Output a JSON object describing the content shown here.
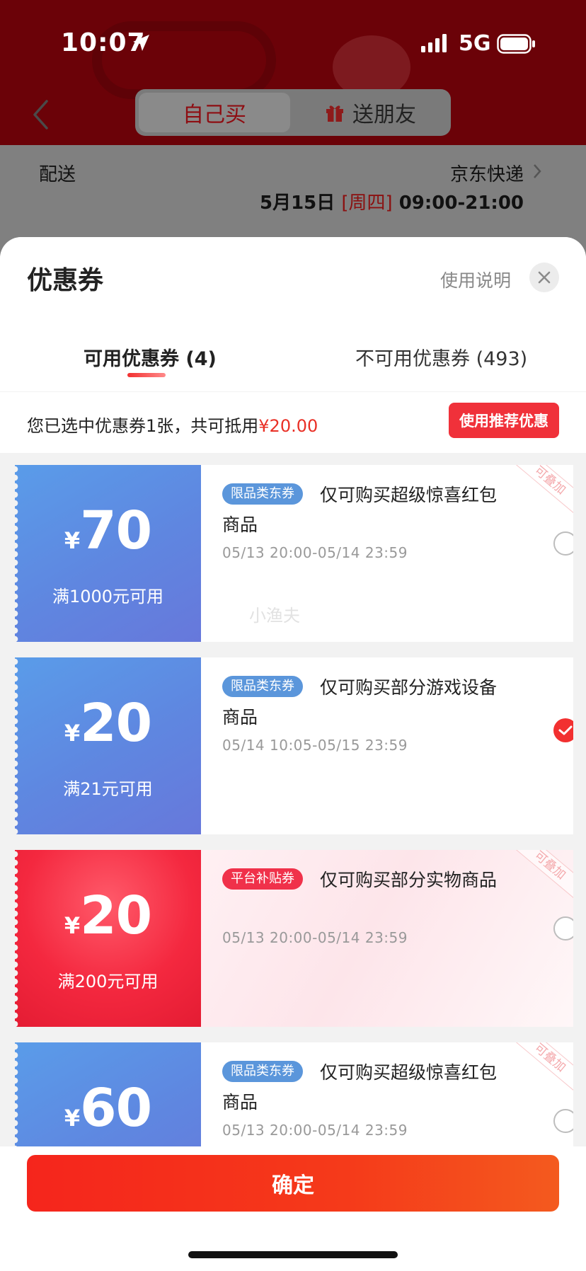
{
  "status_bar": {
    "time": "10:07",
    "network": "5G"
  },
  "header": {
    "tab_self": "自己买",
    "tab_gift": "送朋友"
  },
  "delivery": {
    "label": "配送",
    "carrier": "京东快递",
    "date": "5月15日",
    "weekday": "[周四]",
    "time_range": "09:00-21:00"
  },
  "sheet": {
    "title": "优惠券",
    "help": "使用说明",
    "tabs": {
      "available": "可用优惠券 (4)",
      "unavailable": "不可用优惠券 (493)"
    },
    "summary_prefix": "您已选中优惠券1张，共可抵用",
    "summary_amount": "¥20.00",
    "recommend": "使用推荐优惠"
  },
  "coupons": [
    {
      "currency": "¥",
      "amount": "70",
      "condition": "满1000元可用",
      "tag": "限品类东券",
      "title": "仅可购买超级惊喜红包商品",
      "period": "05/13 20:00-05/14 23:59",
      "badge": "可叠加",
      "selected": false
    },
    {
      "currency": "¥",
      "amount": "20",
      "condition": "满21元可用",
      "tag": "限品类东券",
      "title": "仅可购买部分游戏设备商品",
      "period": "05/14 10:05-05/15 23:59",
      "badge": "",
      "selected": true
    },
    {
      "currency": "¥",
      "amount": "20",
      "condition": "满200元可用",
      "tag": "平台补贴券",
      "title": "仅可购买部分实物商品",
      "period": "05/13 20:00-05/14 23:59",
      "badge": "可叠加",
      "selected": false
    },
    {
      "currency": "¥",
      "amount": "60",
      "condition": "",
      "tag": "限品类东券",
      "title": "仅可购买超级惊喜红包商品",
      "period": "05/13 20:00-05/14 23:59",
      "badge": "可叠加",
      "selected": false
    }
  ],
  "watermark": "小渔夫",
  "footer": {
    "confirm": "确定"
  },
  "colors": {
    "accent": "#f23030",
    "coupon_blue": "#5f86e0",
    "coupon_red": "#f4283f"
  },
  "icons": [
    "location-arrow-icon",
    "signal-icon",
    "battery-icon",
    "back-chevron-icon",
    "gift-icon",
    "chevron-right-icon",
    "close-icon",
    "check-icon"
  ]
}
